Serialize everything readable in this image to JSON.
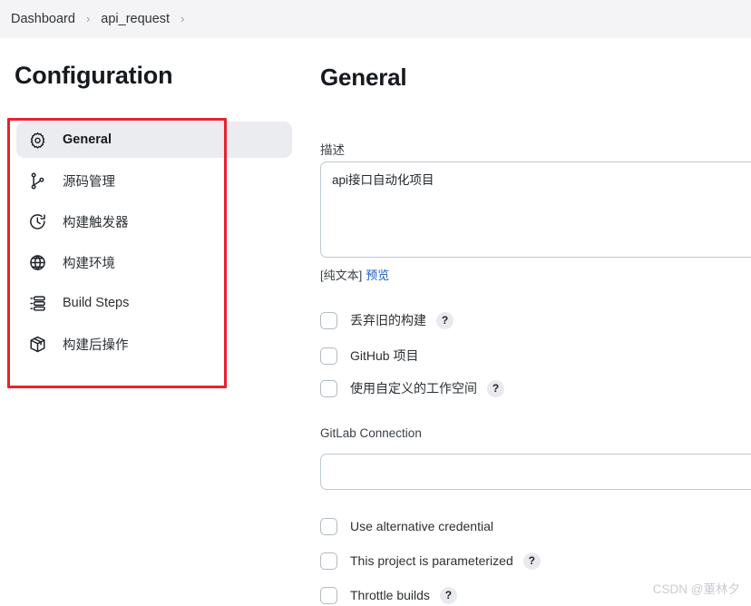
{
  "breadcrumb": {
    "items": [
      {
        "label": "Dashboard"
      },
      {
        "label": "api_request"
      }
    ],
    "separator": "›"
  },
  "sidebar": {
    "title": "Configuration",
    "items": [
      {
        "label": "General",
        "icon": "gear-icon",
        "active": true
      },
      {
        "label": "源码管理",
        "icon": "git-branch-icon",
        "active": false
      },
      {
        "label": "构建触发器",
        "icon": "clock-icon",
        "active": false
      },
      {
        "label": "构建环境",
        "icon": "globe-icon",
        "active": false
      },
      {
        "label": "Build Steps",
        "icon": "tasks-list-icon",
        "active": false
      },
      {
        "label": "构建后操作",
        "icon": "package-icon",
        "active": false
      }
    ],
    "highlight_color": "#ebecf0",
    "annotation_color": "#e8222c"
  },
  "main": {
    "title": "General",
    "description": {
      "label": "描述",
      "value": "api接口自动化项目",
      "plain_text_note": "[纯文本]",
      "preview_link": "预览"
    },
    "checkboxes_top": [
      {
        "label": "丢弃旧的构建",
        "checked": false,
        "help": true,
        "help_glyph": "?"
      },
      {
        "label": "GitHub 项目",
        "checked": false,
        "help": false,
        "help_glyph": "?"
      },
      {
        "label": "使用自定义的工作空间",
        "checked": false,
        "help": true,
        "help_glyph": "?"
      }
    ],
    "gitlab": {
      "label": "GitLab Connection",
      "value": "",
      "placeholder": ""
    },
    "checkboxes_bottom": [
      {
        "label": "Use alternative credential",
        "checked": false,
        "help": false,
        "help_glyph": "?"
      },
      {
        "label": "This project is parameterized",
        "checked": false,
        "help": true,
        "help_glyph": "?"
      },
      {
        "label": "Throttle builds",
        "checked": false,
        "help": true,
        "help_glyph": "?"
      }
    ]
  },
  "watermark": {
    "text": "CSDN @董林夕"
  }
}
